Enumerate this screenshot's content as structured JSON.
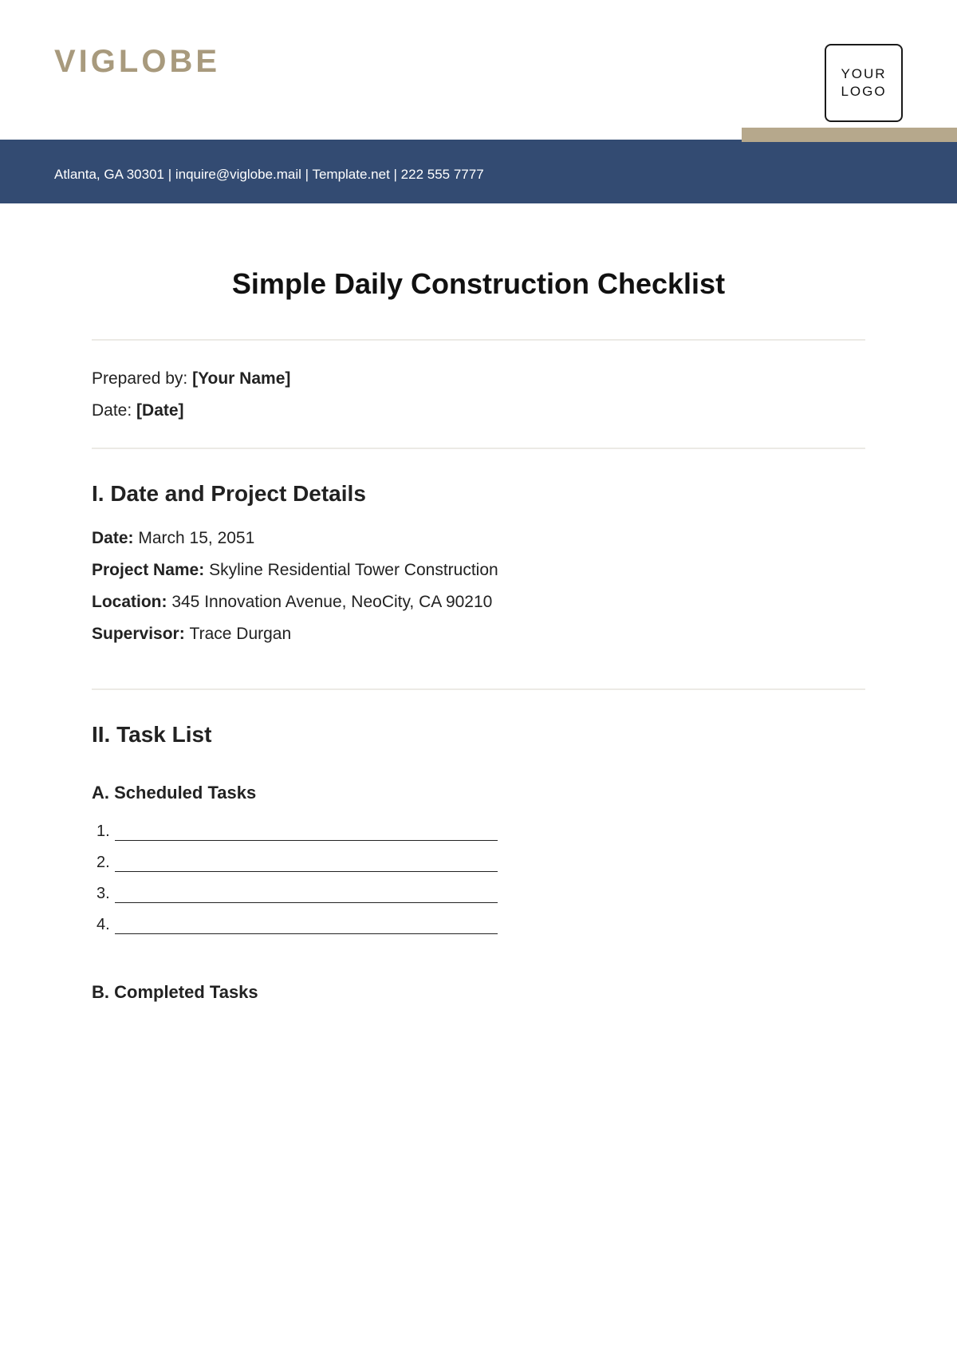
{
  "header": {
    "brand": "VIGLOBE",
    "logo_text": "YOUR\nLOGO",
    "contact_line": "Atlanta, GA 30301 | inquire@viglobe.mail | Template.net | 222 555 7777"
  },
  "title": "Simple Daily Construction Checklist",
  "meta": {
    "prepared_by_label": "Prepared by: ",
    "prepared_by_value": "[Your Name]",
    "date_label": "Date: ",
    "date_value": "[Date]"
  },
  "section1": {
    "heading": "I. Date and Project Details",
    "rows": [
      {
        "label": "Date: ",
        "value": "March 15, 2051"
      },
      {
        "label": "Project Name: ",
        "value": "Skyline Residential Tower Construction"
      },
      {
        "label": "Location: ",
        "value": "345 Innovation Avenue, NeoCity, CA 90210"
      },
      {
        "label": "Supervisor: ",
        "value": "Trace Durgan"
      }
    ]
  },
  "section2": {
    "heading": "II. Task List",
    "subA": "A. Scheduled Tasks",
    "scheduled": [
      "1.",
      "2.",
      "3.",
      "4."
    ],
    "subB": "B. Completed Tasks"
  }
}
